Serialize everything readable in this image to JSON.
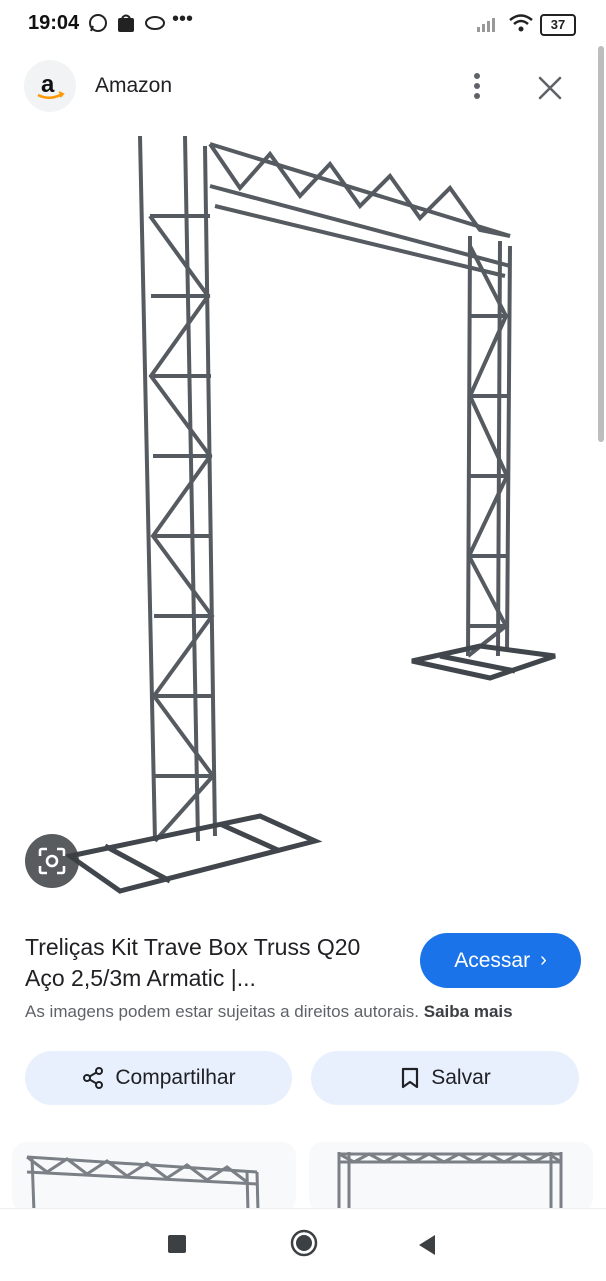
{
  "status_bar": {
    "time": "19:04",
    "battery": "37",
    "icons": [
      "whatsapp-icon",
      "shopping-bag-icon",
      "cloud-icon",
      "more-notifications-icon",
      "signal-icon",
      "wifi-icon",
      "battery-icon"
    ]
  },
  "header": {
    "site_name": "Amazon",
    "logo_letter": "a"
  },
  "result": {
    "title_line1": "Treliças Kit Trave Box Truss Q20",
    "title_line2": "Aço 2,5/3m Armatic |...",
    "visit_label": "Acessar",
    "copyright_text": "As imagens podem estar sujeitas a direitos autorais.",
    "learn_more": "Saiba mais"
  },
  "actions": {
    "share_label": "Compartilhar",
    "save_label": "Salvar"
  },
  "colors": {
    "accent": "#1a73e8",
    "pill_bg": "#e8f0fe",
    "text_secondary": "#5f6368"
  }
}
